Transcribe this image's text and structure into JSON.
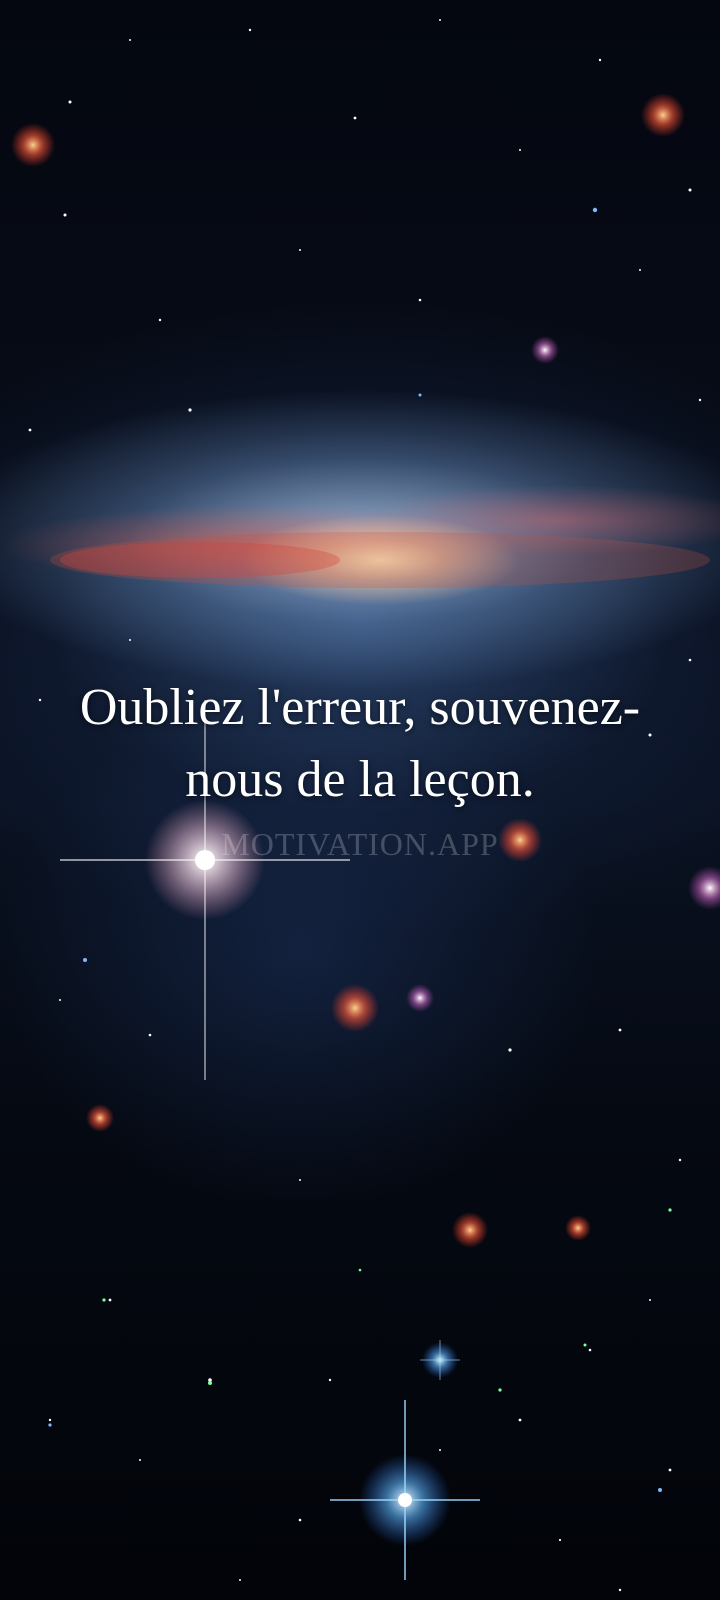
{
  "quote": {
    "text": "Oubliez l'erreur, souvenez-nous de la leçon.",
    "watermark": "MOTIVATION.APP"
  },
  "colors": {
    "background": "#03060d",
    "text": "#ffffff",
    "watermark": "rgba(255,255,255,0.22)"
  }
}
